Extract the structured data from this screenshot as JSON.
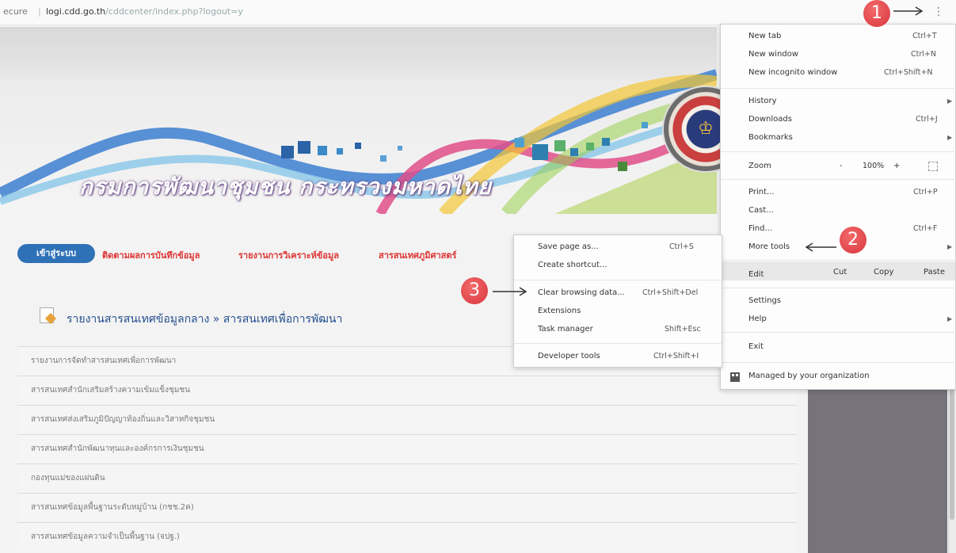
{
  "browser": {
    "secure_label": "ecure",
    "separator": "|",
    "url_host": "logi.cdd.go.th",
    "url_path": "/cddcenter/index.php?logout=y",
    "menu_icon": "kebab-menu-icon"
  },
  "banner": {
    "title": "กรมการพัฒนาชุมชน กระทรวงมหาดไทย",
    "seal_glyph": "♔"
  },
  "nav": {
    "login": "เข้าสู่ระบบ",
    "links": [
      "ติดตามผลการบันทึกข้อมูล",
      "รายงานการวิเคราะห์ข้อมูล",
      "สารสนเทศภูมิศาสตร์"
    ]
  },
  "section": {
    "title": "รายงานสารสนเทศข้อมูลกลาง » สารสนเทศเพื่อการพัฒนา"
  },
  "list": [
    "รายงานการจัดทำสารสนเทศเพื่อการพัฒนา",
    "สารสนเทศสำนักเสริมสร้างความเข้มแข็งชุมชน",
    "สารสนเทศส่งเสริมภูมิปัญญาท้องถิ่นและวิสาหกิจชุมชน",
    "สารสนเทศสำนักพัฒนาทุนและองค์กรการเงินชุมชน",
    "กองทุนแม่ของแผ่นดิน",
    "สารสนเทศข้อมูลพื้นฐานระดับหมู่บ้าน (กชช.2ค)",
    "สารสนเทศข้อมูลความจำเป็นพื้นฐาน (จปฐ.)"
  ],
  "menu": {
    "new_tab": "New tab",
    "new_tab_sc": "Ctrl+T",
    "new_window": "New window",
    "new_window_sc": "Ctrl+N",
    "incognito": "New incognito window",
    "incognito_sc": "Ctrl+Shift+N",
    "history": "History",
    "downloads": "Downloads",
    "downloads_sc": "Ctrl+J",
    "bookmarks": "Bookmarks",
    "zoom": "Zoom",
    "zoom_minus": "-",
    "zoom_value": "100%",
    "zoom_plus": "+",
    "print": "Print...",
    "print_sc": "Ctrl+P",
    "cast": "Cast...",
    "find": "Find...",
    "find_sc": "Ctrl+F",
    "more_tools": "More tools",
    "edit": "Edit",
    "cut": "Cut",
    "copy": "Copy",
    "paste": "Paste",
    "settings": "Settings",
    "help": "Help",
    "exit": "Exit",
    "managed": "Managed by your organization"
  },
  "submenu": {
    "save_page": "Save page as...",
    "save_page_sc": "Ctrl+S",
    "create_shortcut": "Create shortcut...",
    "clear_data": "Clear browsing data...",
    "clear_data_sc": "Ctrl+Shift+Del",
    "extensions": "Extensions",
    "task_manager": "Task manager",
    "task_manager_sc": "Shift+Esc",
    "dev_tools": "Developer tools",
    "dev_tools_sc": "Ctrl+Shift+I"
  },
  "callouts": [
    "1",
    "2",
    "3"
  ]
}
